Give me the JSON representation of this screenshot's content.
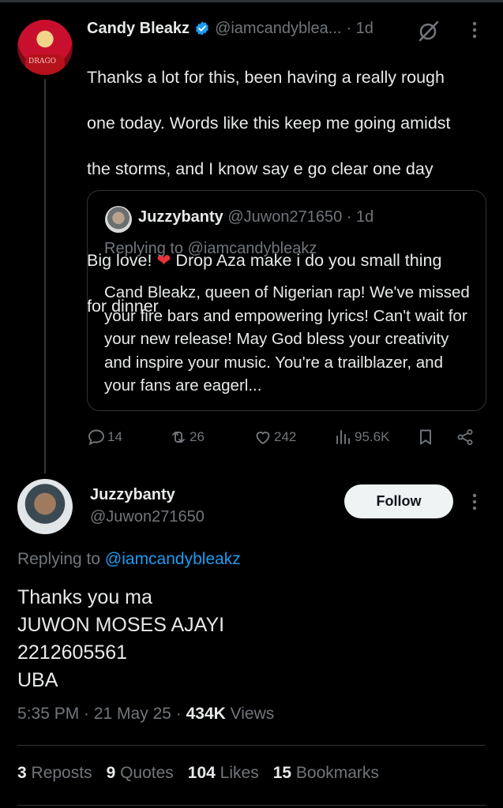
{
  "parent_tweet": {
    "name": "Candy Bleakz",
    "handle": "@iamcandyblea...",
    "time": "· 1d",
    "lines": [
      "Thanks a lot for this, been having a really rough",
      "one today. Words like this keep me going amidst",
      "the storms, and I know say e go clear one day",
      "",
      "Big love! ❤️ Drop Aza make i do you small thing",
      "for dinner"
    ],
    "quote": {
      "name": "Juzzybanty",
      "handle": "@Juwon271650",
      "time": "· 1d",
      "replying_to": "Replying to @iamcandybleakz",
      "text": "Cand Bleakz, queen of Nigerian rap! We've missed your fire bars and empowering lyrics! Can't wait for your new release! May God bless your creativity and inspire your music. You're a trailblazer, and your fans are eagerl..."
    },
    "actions": {
      "replies": "14",
      "reposts": "26",
      "likes": "242",
      "views": "95.6K"
    }
  },
  "main_tweet": {
    "name": "Juzzybanty",
    "handle": "@Juwon271650",
    "follow_label": "Follow",
    "replying_prefix": "Replying to ",
    "replying_handle": "@iamcandybleakz",
    "lines": [
      "Thanks you ma",
      "JUWON MOSES AJAYI",
      "2212605561",
      "UBA"
    ],
    "time": "5:35 PM · 21 May 25 · ",
    "views_count": "434K",
    "views_label": " Views",
    "stats": {
      "reposts_count": "3",
      "reposts_label": " Reposts",
      "quotes_count": "9",
      "quotes_label": " Quotes",
      "likes_count": "104",
      "likes_label": " Likes",
      "bookmarks_count": "15",
      "bookmarks_label": " Bookmarks"
    }
  },
  "colors": {
    "background": "#000000",
    "text": "#e7e9ea",
    "muted": "#71767b",
    "link": "#1d9bf0",
    "verified": "#1d9bf0",
    "heart": "#e8313b"
  },
  "icons": [
    "verified-badge-icon",
    "grok-icon",
    "more-icon",
    "reply-icon",
    "repost-icon",
    "like-icon",
    "views-icon",
    "bookmark-icon",
    "share-icon"
  ]
}
